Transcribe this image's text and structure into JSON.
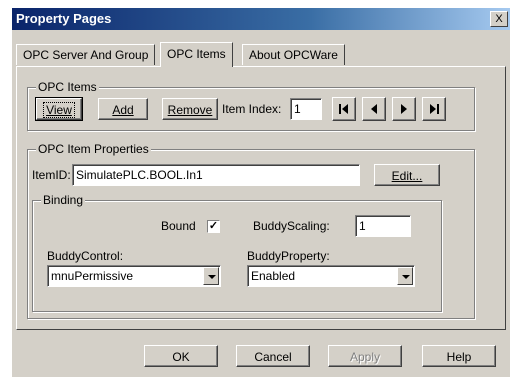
{
  "window": {
    "title": "Property Pages",
    "close_label": "X"
  },
  "tabs": [
    {
      "label": "OPC Server And Group",
      "active": false
    },
    {
      "label": "OPC Items",
      "active": true
    },
    {
      "label": "About OPCWare",
      "active": false
    }
  ],
  "opc_items": {
    "group_label": "OPC Items",
    "view_label": "View",
    "add_label": "Add",
    "remove_label": "Remove",
    "item_index_label": "Item Index:",
    "item_index_value": "1",
    "nav_icons": [
      "first-record-icon",
      "previous-record-icon",
      "next-record-icon",
      "last-record-icon"
    ]
  },
  "properties": {
    "group_label": "OPC Item Properties",
    "itemid_label": "ItemID:",
    "itemid_value": "SimulatePLC.BOOL.In1",
    "edit_label": "Edit..."
  },
  "binding": {
    "group_label": "Binding",
    "bound_label": "Bound",
    "bound_checked": true,
    "buddy_scaling_label": "BuddyScaling:",
    "buddy_scaling_value": "1",
    "buddy_control_label": "BuddyControl:",
    "buddy_control_value": "mnuPermissive",
    "buddy_property_label": "BuddyProperty:",
    "buddy_property_value": "Enabled"
  },
  "footer": {
    "ok_label": "OK",
    "cancel_label": "Cancel",
    "apply_label": "Apply",
    "help_label": "Help"
  },
  "colors": {
    "titlebar_start": "#0a246a",
    "titlebar_end": "#a6caf0",
    "face": "#d4d0c8"
  }
}
